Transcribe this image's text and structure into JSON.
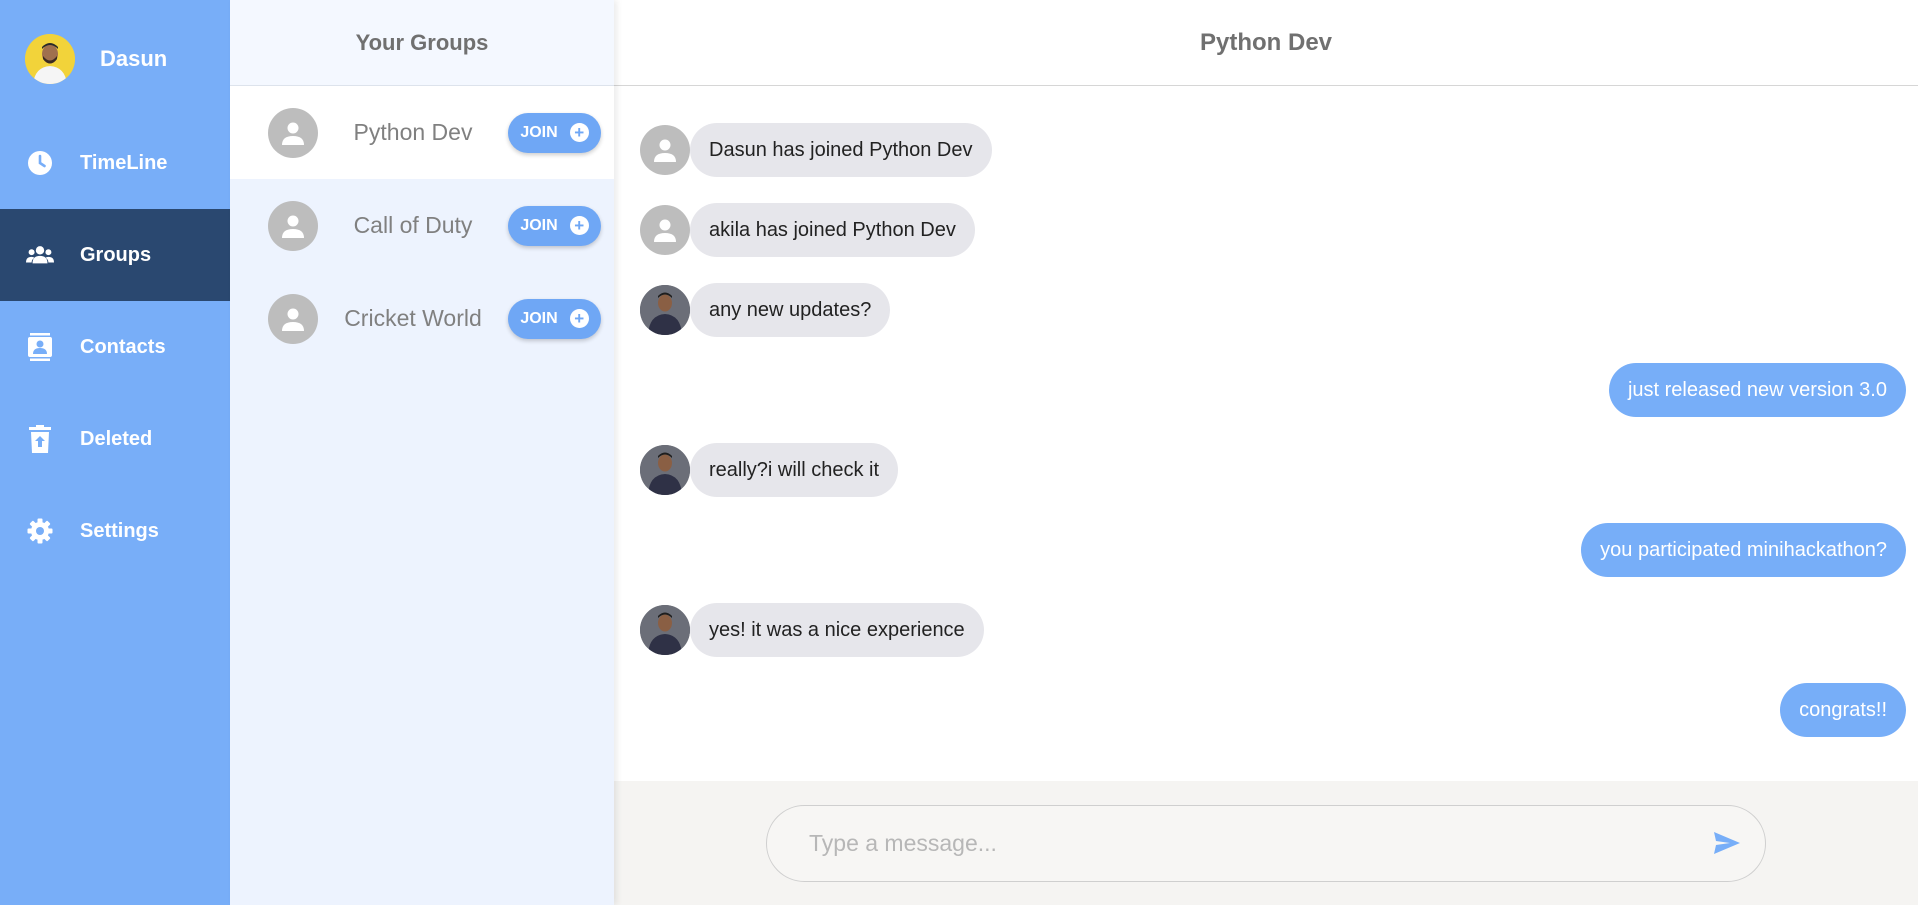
{
  "user": {
    "name": "Dasun"
  },
  "sidebar": {
    "items": [
      {
        "label": "TimeLine",
        "icon": "clock-icon"
      },
      {
        "label": "Groups",
        "icon": "people-icon",
        "active": true
      },
      {
        "label": "Contacts",
        "icon": "contact-card-icon"
      },
      {
        "label": "Deleted",
        "icon": "trash-restore-icon"
      },
      {
        "label": "Settings",
        "icon": "gear-icon"
      }
    ]
  },
  "groups": {
    "header": "Your Groups",
    "join_label": "JOIN",
    "items": [
      {
        "name": "Python Dev",
        "selected": true
      },
      {
        "name": "Call of Duty"
      },
      {
        "name": "Cricket World"
      }
    ]
  },
  "chat": {
    "title": "Python Dev",
    "messages": [
      {
        "text": "Dasun has joined Python Dev",
        "direction": "incoming",
        "avatar": "system"
      },
      {
        "text": "akila has joined Python Dev",
        "direction": "incoming",
        "avatar": "system"
      },
      {
        "text": "any new updates?",
        "direction": "incoming",
        "avatar": "person"
      },
      {
        "text": "just released new version 3.0",
        "direction": "outgoing"
      },
      {
        "text": "really?i will check it",
        "direction": "incoming",
        "avatar": "person"
      },
      {
        "text": "you participated minihackathon?",
        "direction": "outgoing"
      },
      {
        "text": "yes! it was a nice experience",
        "direction": "incoming",
        "avatar": "person"
      },
      {
        "text": "congrats!!",
        "direction": "outgoing"
      }
    ],
    "composer": {
      "placeholder": "Type a message..."
    }
  },
  "colors": {
    "sidebar": "#78aef8",
    "sidebar_active": "#2a4870",
    "outgoing_bubble": "#77aef8",
    "incoming_bubble": "#e6e6eb",
    "join_button": "#6fa7f5"
  }
}
